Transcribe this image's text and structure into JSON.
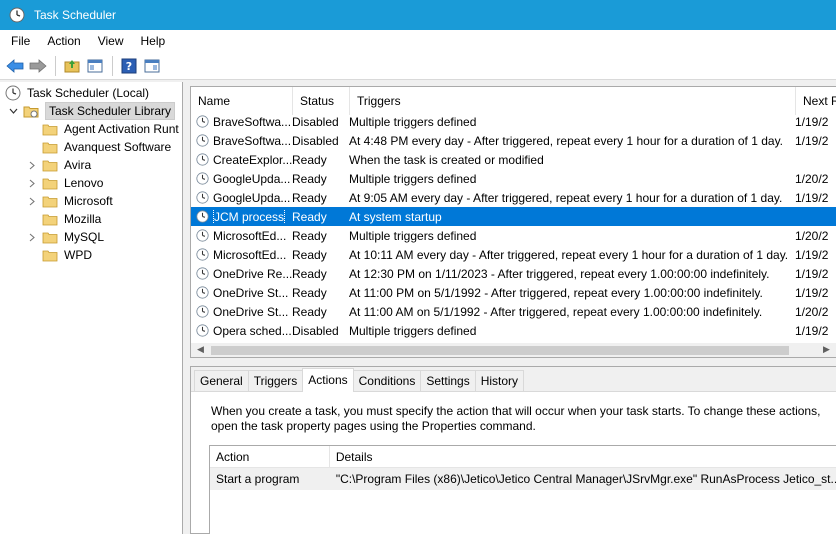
{
  "window": {
    "title": "Task Scheduler"
  },
  "menu": [
    "File",
    "Action",
    "View",
    "Help"
  ],
  "tree": {
    "root": "Task Scheduler (Local)",
    "library": "Task Scheduler Library",
    "folders": [
      {
        "label": "Agent Activation Runt",
        "expandable": false
      },
      {
        "label": "Avanquest Software",
        "expandable": false
      },
      {
        "label": "Avira",
        "expandable": true
      },
      {
        "label": "Lenovo",
        "expandable": true
      },
      {
        "label": "Microsoft",
        "expandable": true
      },
      {
        "label": "Mozilla",
        "expandable": false
      },
      {
        "label": "MySQL",
        "expandable": true
      },
      {
        "label": "WPD",
        "expandable": false
      }
    ]
  },
  "columns": {
    "name": "Name",
    "status": "Status",
    "triggers": "Triggers",
    "next": "Next R"
  },
  "tasks": [
    {
      "name": "BraveSoftwa...",
      "status": "Disabled",
      "triggers": "Multiple triggers defined",
      "next": "1/19/2"
    },
    {
      "name": "BraveSoftwa...",
      "status": "Disabled",
      "triggers": "At 4:48 PM every day - After triggered, repeat every 1 hour for a duration of 1 day.",
      "next": "1/19/2"
    },
    {
      "name": "CreateExplor...",
      "status": "Ready",
      "triggers": "When the task is created or modified",
      "next": ""
    },
    {
      "name": "GoogleUpda...",
      "status": "Ready",
      "triggers": "Multiple triggers defined",
      "next": "1/20/2"
    },
    {
      "name": "GoogleUpda...",
      "status": "Ready",
      "triggers": "At 9:05 AM every day - After triggered, repeat every 1 hour for a duration of 1 day.",
      "next": "1/19/2"
    },
    {
      "name": "JCM process",
      "status": "Ready",
      "triggers": "At system startup",
      "next": "",
      "selected": true
    },
    {
      "name": "MicrosoftEd...",
      "status": "Ready",
      "triggers": "Multiple triggers defined",
      "next": "1/20/2"
    },
    {
      "name": "MicrosoftEd...",
      "status": "Ready",
      "triggers": "At 10:11 AM every day - After triggered, repeat every 1 hour for a duration of 1 day.",
      "next": "1/19/2"
    },
    {
      "name": "OneDrive Re...",
      "status": "Ready",
      "triggers": "At 12:30 PM on 1/11/2023 - After triggered, repeat every 1.00:00:00 indefinitely.",
      "next": "1/19/2"
    },
    {
      "name": "OneDrive St...",
      "status": "Ready",
      "triggers": "At 11:00 PM on 5/1/1992 - After triggered, repeat every 1.00:00:00 indefinitely.",
      "next": "1/19/2"
    },
    {
      "name": "OneDrive St...",
      "status": "Ready",
      "triggers": "At 11:00 AM on 5/1/1992 - After triggered, repeat every 1.00:00:00 indefinitely.",
      "next": "1/20/2"
    },
    {
      "name": "Opera sched...",
      "status": "Disabled",
      "triggers": "Multiple triggers defined",
      "next": "1/19/2"
    }
  ],
  "tabs": [
    "General",
    "Triggers",
    "Actions",
    "Conditions",
    "Settings",
    "History"
  ],
  "active_tab": "Actions",
  "details": {
    "description": "When you create a task, you must specify the action that will occur when your task starts.  To change these actions, open the task property pages using the Properties command.",
    "action_header": "Action",
    "details_header": "Details",
    "rows": [
      {
        "action": "Start a program",
        "details": "\"C:\\Program Files (x86)\\Jetico\\Jetico Central Manager\\JSrvMgr.exe\" RunAsProcess Jetico_st..."
      }
    ]
  },
  "colors": {
    "titlebar": "#1a9bd7",
    "selection": "#0078d7"
  }
}
